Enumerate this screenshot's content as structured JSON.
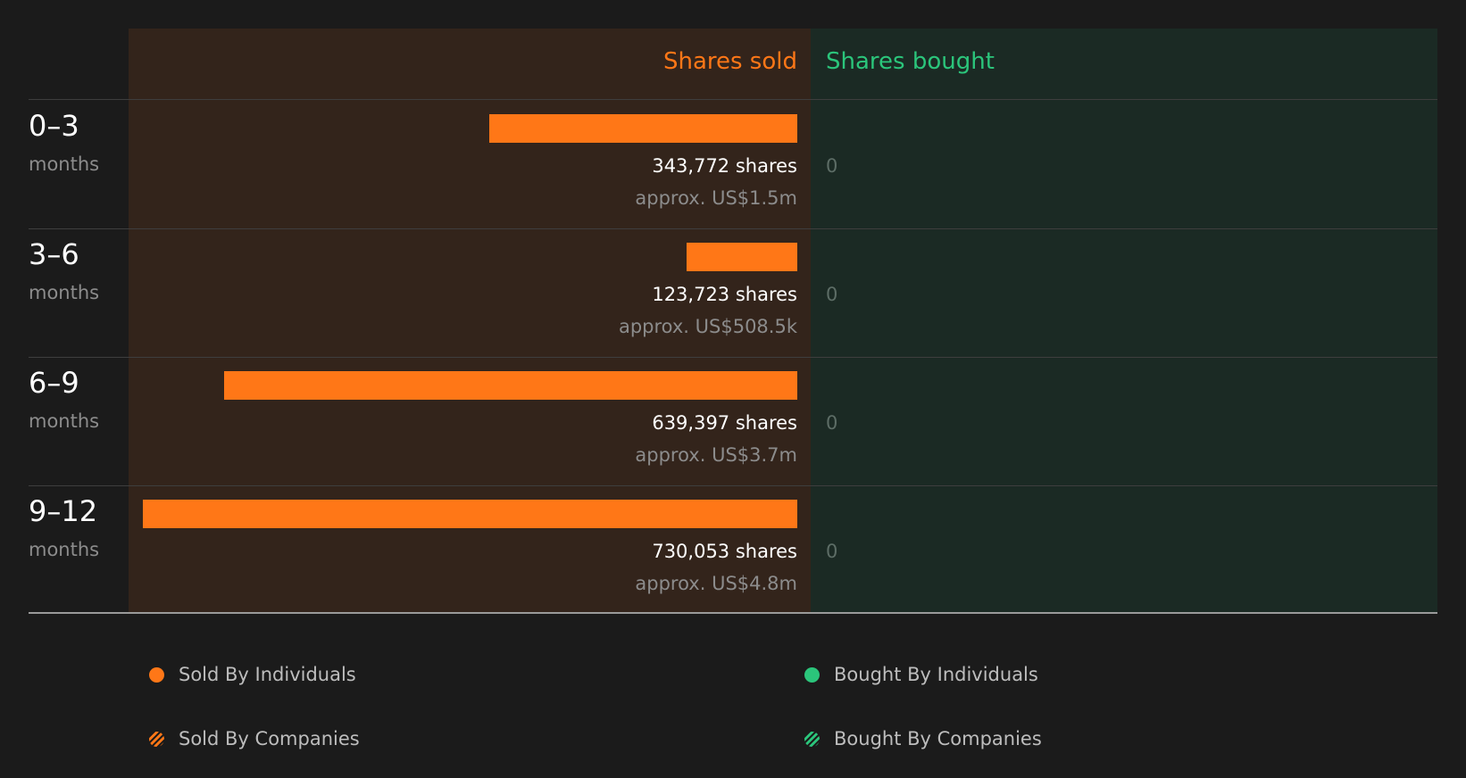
{
  "chart_data": {
    "type": "bar",
    "headers": {
      "sold": "Shares sold",
      "bought": "Shares bought"
    },
    "categories": [
      {
        "period": "0–3",
        "unit": "months"
      },
      {
        "period": "3–6",
        "unit": "months"
      },
      {
        "period": "6–9",
        "unit": "months"
      },
      {
        "period": "9–12",
        "unit": "months"
      }
    ],
    "series": [
      {
        "name": "Sold By Individuals",
        "values": [
          343772,
          123723,
          639397,
          730053
        ]
      },
      {
        "name": "Bought By Individuals",
        "values": [
          0,
          0,
          0,
          0
        ]
      }
    ],
    "rows": [
      {
        "shares_label": "343,772 shares",
        "value_label": "approx. US$1.5m",
        "bought_label": "0"
      },
      {
        "shares_label": "123,723 shares",
        "value_label": "approx. US$508.5k",
        "bought_label": "0"
      },
      {
        "shares_label": "639,397 shares",
        "value_label": "approx. US$3.7m",
        "bought_label": "0"
      },
      {
        "shares_label": "730,053 shares",
        "value_label": "approx. US$4.8m",
        "bought_label": "0"
      }
    ],
    "max_value": 730053,
    "legend": [
      {
        "label": "Sold By Individuals",
        "style": "solid",
        "color": "#ff7717"
      },
      {
        "label": "Bought By Individuals",
        "style": "solid",
        "color": "#2bc57b"
      },
      {
        "label": "Sold By Companies",
        "style": "hatched",
        "color": "#ff7717"
      },
      {
        "label": "Bought By Companies",
        "style": "hatched",
        "color": "#2bc57b"
      }
    ],
    "legend_position": "bottom",
    "colors": {
      "sold": "#ff7717",
      "bought": "#2bc57b",
      "sold_panel": "#33241b",
      "bought_panel": "#1b2a24",
      "background": "#1b1b1b"
    }
  }
}
